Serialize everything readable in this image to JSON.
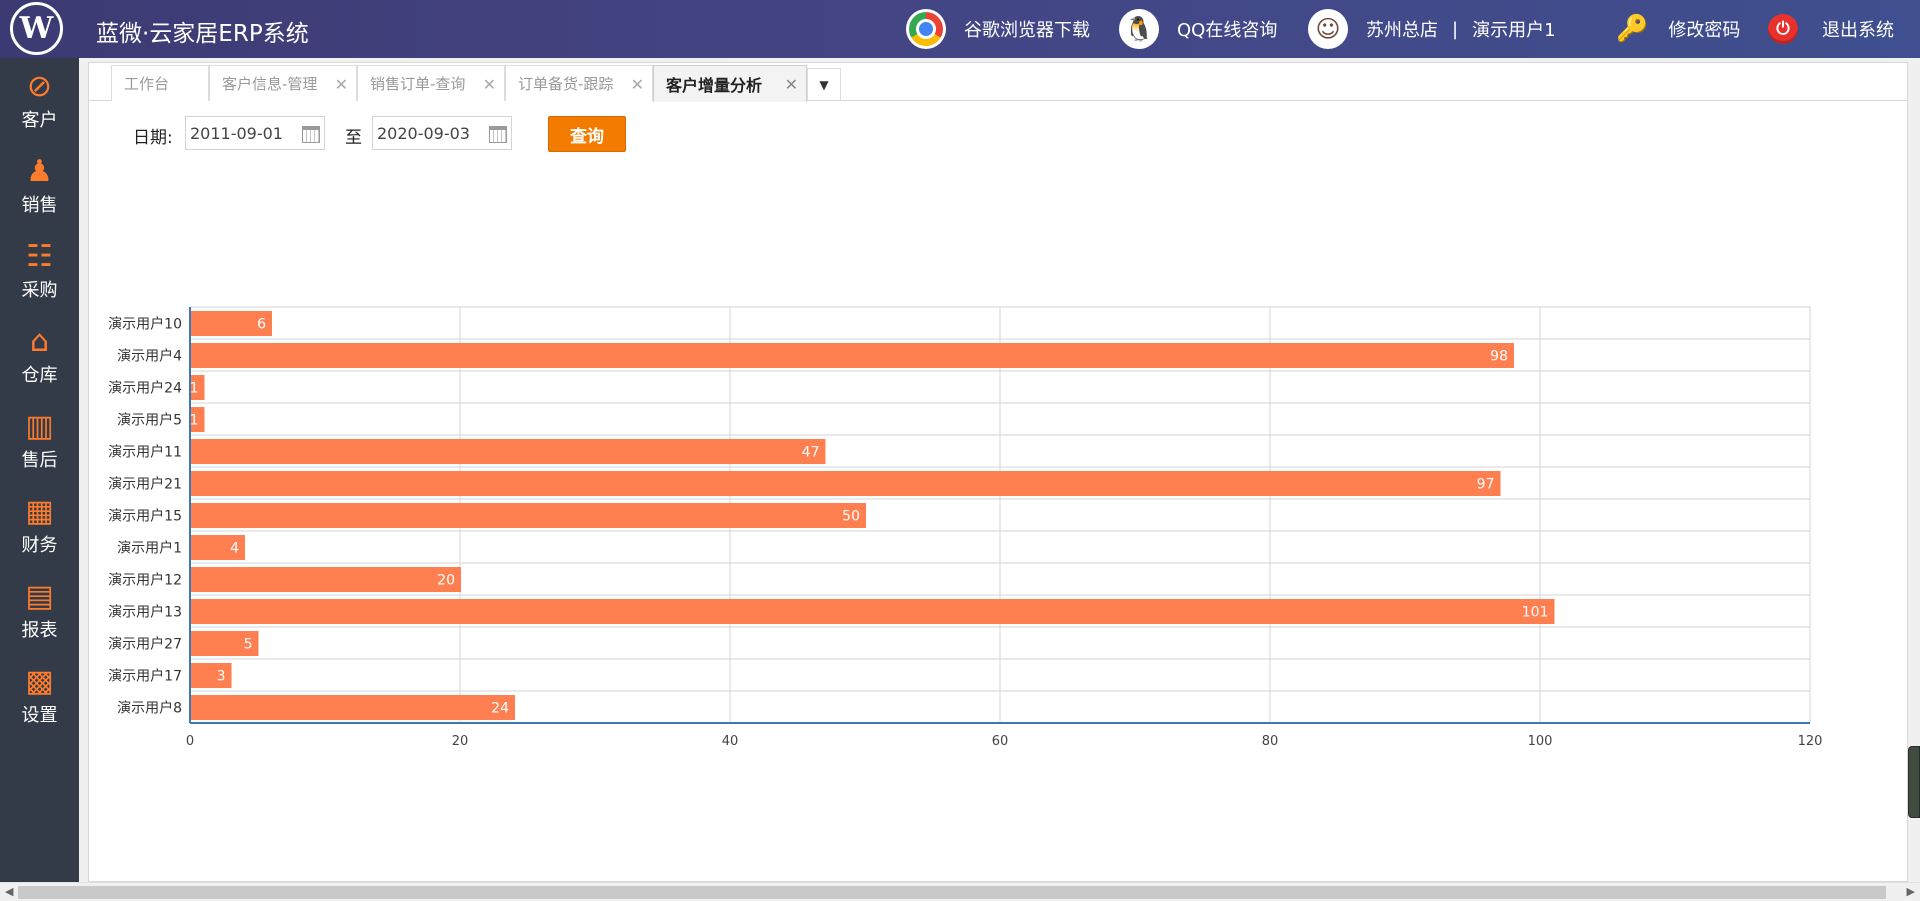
{
  "header": {
    "logo": "W",
    "app_title": "蓝微·云家居ERP系统",
    "chrome_download": "谷歌浏览器下载",
    "qq_consult": "QQ在线咨询",
    "store": "苏州总店",
    "separator": "|",
    "user": "演示用户1",
    "change_password": "修改密码",
    "logout": "退出系统"
  },
  "sidebar": {
    "items": [
      {
        "label": "客户",
        "icon": "compass-icon",
        "glyph": "⊘"
      },
      {
        "label": "销售",
        "icon": "person-icon",
        "glyph": "♟"
      },
      {
        "label": "采购",
        "icon": "cart-icon",
        "glyph": "☷"
      },
      {
        "label": "仓库",
        "icon": "home-icon",
        "glyph": "⌂"
      },
      {
        "label": "售后",
        "icon": "bars-icon",
        "glyph": "▥"
      },
      {
        "label": "财务",
        "icon": "grid-icon",
        "glyph": "▦"
      },
      {
        "label": "报表",
        "icon": "report-icon",
        "glyph": "▤"
      },
      {
        "label": "设置",
        "icon": "keyboard-icon",
        "glyph": "▩"
      }
    ]
  },
  "tabs": [
    {
      "label": "工作台",
      "closable": false
    },
    {
      "label": "客户信息-管理",
      "closable": true
    },
    {
      "label": "销售订单-查询",
      "closable": true
    },
    {
      "label": "订单备货-跟踪",
      "closable": true
    },
    {
      "label": "客户增量分析",
      "closable": true,
      "active": true
    }
  ],
  "tab_close_glyph": "✕",
  "tab_more_glyph": "▼",
  "filter": {
    "date_label": "日期:",
    "start_date": "2011-09-01",
    "to_label": "至",
    "end_date": "2020-09-03",
    "query_button": "查询"
  },
  "colors": {
    "bar": "#ff7f50",
    "accent": "#f27b00",
    "sidebar": "#343b48",
    "axis": "#3a78b8"
  },
  "chart_data": {
    "type": "bar",
    "orientation": "horizontal",
    "categories": [
      "演示用户10",
      "演示用户4",
      "演示用户24",
      "演示用户5",
      "演示用户11",
      "演示用户21",
      "演示用户15",
      "演示用户1",
      "演示用户12",
      "演示用户13",
      "演示用户27",
      "演示用户17",
      "演示用户8"
    ],
    "values": [
      6,
      98,
      1,
      1,
      47,
      97,
      50,
      4,
      20,
      101,
      5,
      3,
      24
    ],
    "xlim": [
      0,
      120
    ],
    "xticks": [
      0,
      20,
      40,
      60,
      80,
      100,
      120
    ],
    "grid": true,
    "data_labels": true,
    "title": "",
    "xlabel": "",
    "ylabel": ""
  }
}
